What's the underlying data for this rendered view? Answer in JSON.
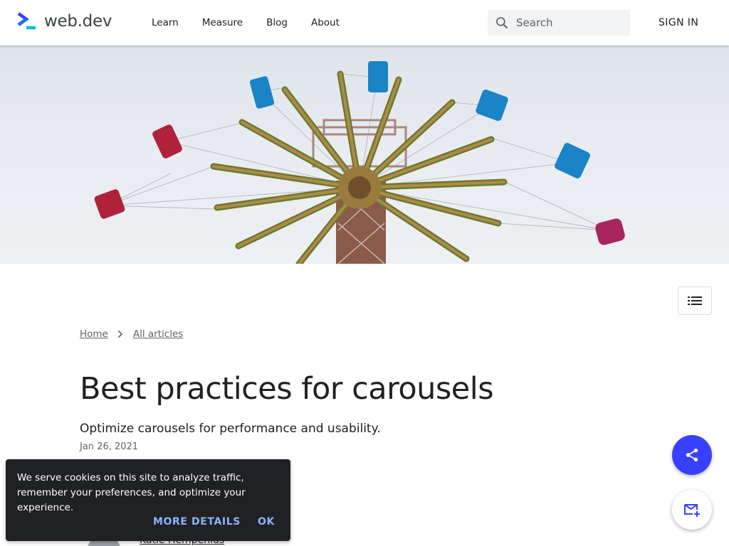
{
  "header": {
    "logo_text": "web.dev",
    "nav": [
      "Learn",
      "Measure",
      "Blog",
      "About"
    ],
    "search_placeholder": "Search",
    "signin_label": "SIGN IN"
  },
  "breadcrumb": {
    "home": "Home",
    "all_articles": "All articles"
  },
  "article": {
    "title": "Best practices for carousels",
    "subtitle": "Optimize carousels for performance and usability.",
    "date": "Jan 26, 2021",
    "author": "Katie Hempenius"
  },
  "cookie": {
    "text": "We serve cookies on this site to analyze traffic, remember your preferences, and optimize your experience.",
    "more_label": "MORE DETAILS",
    "ok_label": "OK"
  },
  "colors": {
    "accent": "#3740ff",
    "link_blue": "#8ab4f8",
    "dark": "#202124"
  },
  "icons": [
    "logo-chevron-icon",
    "search-icon",
    "list-icon",
    "chevron-right-icon",
    "share-icon",
    "mail-add-icon"
  ]
}
